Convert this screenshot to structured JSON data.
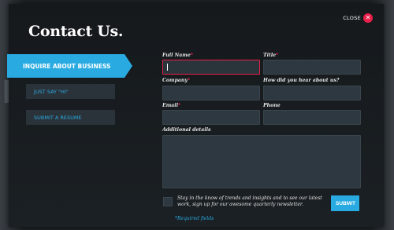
{
  "modal": {
    "title": "Contact Us.",
    "close_label": "CLOSE"
  },
  "nav": {
    "items": [
      {
        "label": "INQUIRE ABOUT BUSINESS",
        "active": true
      },
      {
        "label": "JUST SAY \"HI\"",
        "active": false
      },
      {
        "label": "SUBMIT A RESUME",
        "active": false
      }
    ]
  },
  "form": {
    "full_name": {
      "label": "Full Name",
      "required_mark": "*",
      "value": ""
    },
    "title": {
      "label": "Title",
      "required_mark": "*",
      "value": ""
    },
    "company": {
      "label": "Company",
      "required_mark": "*",
      "value": ""
    },
    "heard": {
      "label": "How did you hear about us?",
      "value": ""
    },
    "email": {
      "label": "Email",
      "required_mark": "*",
      "value": ""
    },
    "phone": {
      "label": "Phone",
      "value": ""
    },
    "details": {
      "label": "Additional details",
      "value": ""
    },
    "newsletter_text": "Stay in the know of trends and insights and to see our latest work, sign up for our awesome quarterly newsletter.",
    "submit_label": "SUBMIT",
    "required_note": "*Required fields"
  },
  "colors": {
    "accent": "#29abe2",
    "error": "#e8204a",
    "modal_bg": "#171b1e"
  }
}
